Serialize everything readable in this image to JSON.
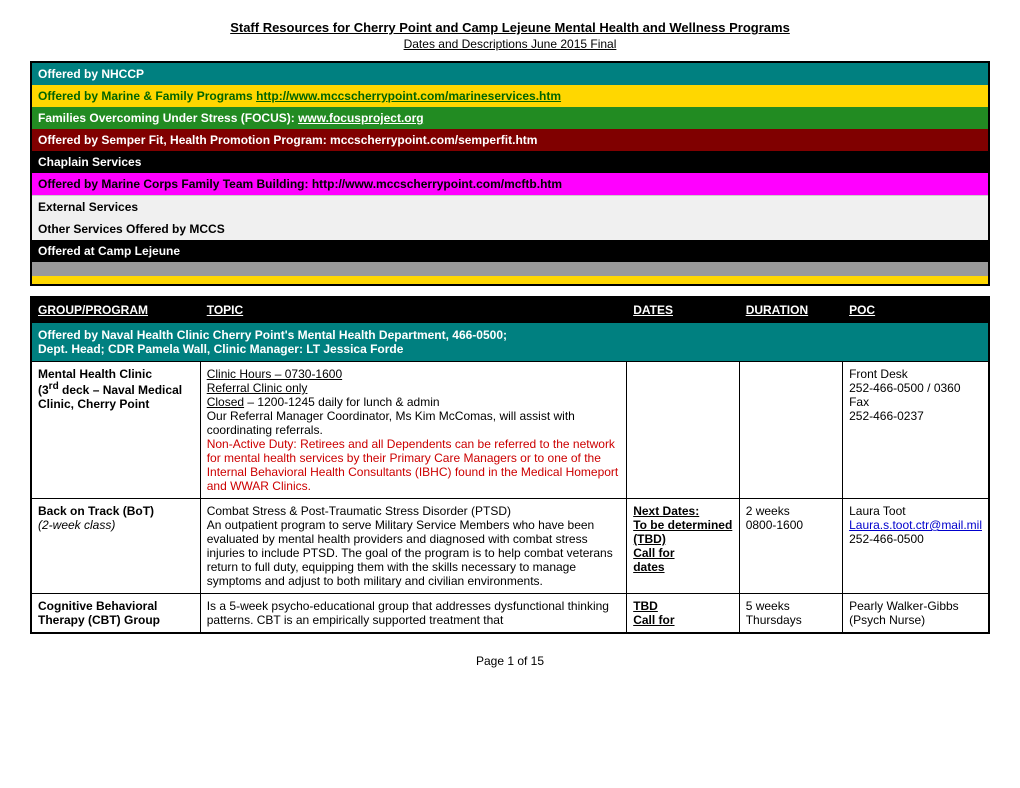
{
  "header": {
    "title": "Staff Resources for Cherry Point and Camp Lejeune Mental Health and Wellness Programs",
    "subtitle": "Dates and Descriptions June 2015 Final"
  },
  "nav": {
    "items": [
      {
        "id": "nhccp",
        "label": "Offered by NHCCP",
        "style": "nhccp",
        "link": null
      },
      {
        "id": "mfp",
        "label": "Offered by Marine & Family Programs",
        "link": "http://www.mccscherrypoint.com/marineservices.htm",
        "style": "mfp"
      },
      {
        "id": "focus",
        "label": "Families Overcoming Under Stress (FOCUS):",
        "link": "www.focusproject.org",
        "style": "focus"
      },
      {
        "id": "semperfit",
        "label": "Offered by Semper Fit, Health Promotion Program:  mccscherrypoint.com/semperfit.htm",
        "link": null,
        "style": "semperfit"
      },
      {
        "id": "chaplain",
        "label": "Chaplain Services",
        "link": null,
        "style": "chaplain"
      },
      {
        "id": "mftb",
        "label": "Offered by Marine Corps Family Team Building: http://www.mccscherrypoint.com/mcftb.htm",
        "link": null,
        "style": "mftb"
      },
      {
        "id": "external",
        "label": "External Services",
        "link": null,
        "style": "external"
      },
      {
        "id": "mccs",
        "label": "Other Services Offered by MCCS",
        "link": null,
        "style": "mccs"
      },
      {
        "id": "lejeune",
        "label": "Offered at Camp Lejeune",
        "link": null,
        "style": "lejeune"
      }
    ]
  },
  "table": {
    "headers": {
      "group": "GROUP/PROGRAM",
      "topic": "TOPIC",
      "dates": "DATES",
      "duration": "DURATION",
      "poc": "POC"
    },
    "section_header": "Offered by Naval Health Clinic Cherry Point's Mental Health Department, 466-0500;\nDept. Head; CDR Pamela Wall, Clinic Manager: LT Jessica Forde",
    "rows": [
      {
        "group": "Mental Health Clinic\n(3rd deck – Naval Medical Clinic, Cherry Point",
        "topic_lines": [
          {
            "text": "Clinic Hours – 0730-1600",
            "style": "underline"
          },
          {
            "text": "Referral Clinic only",
            "style": "underline"
          },
          {
            "text": "Closed – 1200-1245 daily for lunch & admin",
            "style": "normal",
            "prefix": "Closed",
            "prefix_underline": true
          },
          {
            "text": "Our Referral Manager Coordinator, Ms Kim McComas, will assist with coordinating referrals.",
            "style": "normal"
          },
          {
            "text": "Non-Active Duty: Retirees and all Dependents can be referred to the network for mental health services by their Primary Care Managers or to one of the Internal Behavioral Health Consultants (IBHC) found in the Medical Homeport and WWAR Clinics.",
            "style": "red"
          }
        ],
        "dates": "",
        "duration": "",
        "poc": "Front Desk\n252-466-0500 / 0360\nFax\n252-466-0237"
      },
      {
        "group": "Back on Track (BoT)\n(2-week class)",
        "group_italic_part": "(2-week class)",
        "topic_lines": [
          {
            "text": "Combat Stress & Post-Traumatic Stress Disorder (PTSD)",
            "style": "normal"
          },
          {
            "text": "An outpatient program to serve Military Service Members who have been evaluated by mental health providers and diagnosed with combat stress injuries to include PTSD.  The goal of the program is to help combat veterans return to full duty, equipping them with the skills necessary to manage symptoms and adjust to both military and civilian environments.",
            "style": "normal"
          }
        ],
        "dates": "Next Dates:\nTo be determined\n(TBD)\nCall for\ndates",
        "dates_bold": true,
        "duration": "2 weeks\n0800-1600",
        "poc": "Laura Toot\nLaura.s.toot.ctr@mail.mil\n252-466-0500"
      },
      {
        "group": "Cognitive Behavioral Therapy (CBT) Group",
        "topic_lines": [
          {
            "text": "Is a 5-week psycho-educational group that addresses dysfunctional thinking patterns.  CBT is an empirically supported treatment that",
            "style": "normal"
          }
        ],
        "dates": "TBD\nCall for",
        "dates_bold": true,
        "duration": "5 weeks\nThursdays",
        "poc": "Pearly Walker-Gibbs\n(Psych Nurse)"
      }
    ]
  },
  "footer": {
    "text": "Page 1 of 15"
  }
}
